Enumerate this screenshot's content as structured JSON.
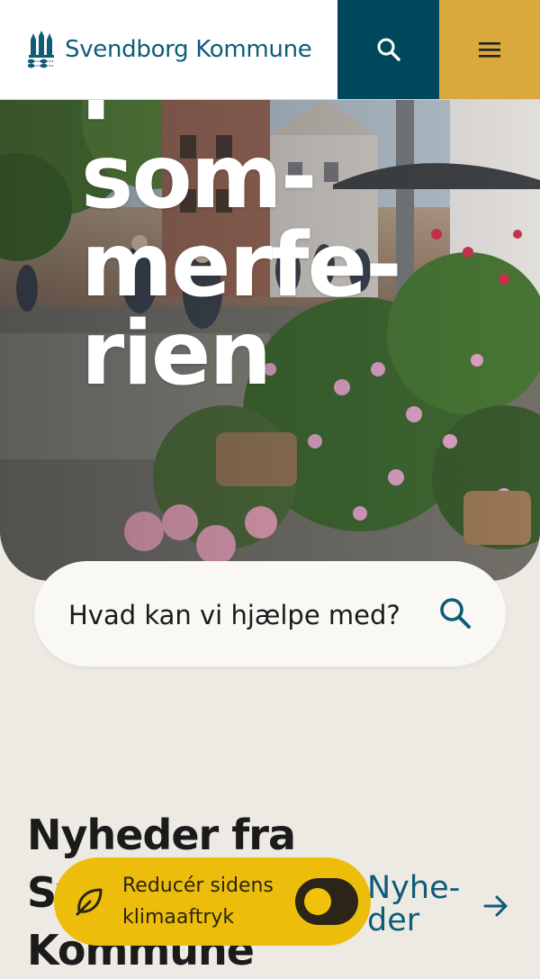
{
  "header": {
    "logo_text": "Svendborg Kommune",
    "search_icon": "search-icon",
    "menu_icon": "hamburger-menu-icon"
  },
  "hero": {
    "title": "i\nsom-\nmerfe-\nrien"
  },
  "search": {
    "placeholder": "Hvad kan vi hjælpe med?",
    "icon": "search-icon"
  },
  "news": {
    "title": "Nyheder fra Svendborg Kommune",
    "link_label": "Nyhe-\nder",
    "link_icon": "arrow-right-icon"
  },
  "climate": {
    "label": "Reducér sidens\nklimaaftryk",
    "icon": "leaf-icon",
    "toggle_on": false
  },
  "colors": {
    "brand_blue": "#0e5c78",
    "dark_teal": "#00485c",
    "gold": "#d9a93e",
    "climate_yellow": "#edbd0b",
    "page_bg": "#edeae4"
  }
}
